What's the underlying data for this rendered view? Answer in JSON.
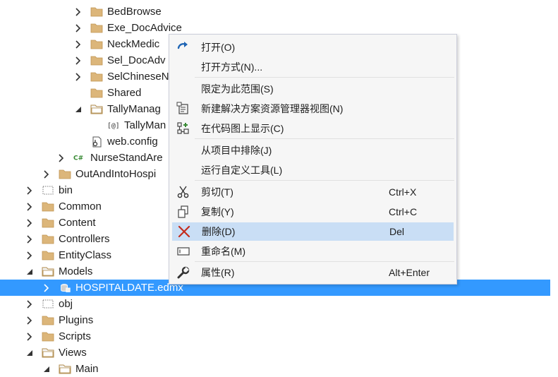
{
  "tree": [
    {
      "label": "BedBrowse",
      "icon": "folder-icon",
      "arrow": "collapsed"
    },
    {
      "label": "Exe_DocAdvice",
      "icon": "folder-icon",
      "arrow": "collapsed"
    },
    {
      "label": "NeckMedic",
      "icon": "folder-icon",
      "arrow": "collapsed"
    },
    {
      "label": "Sel_DocAdv",
      "icon": "folder-icon",
      "arrow": "collapsed"
    },
    {
      "label": "SelChineseN",
      "icon": "folder-icon",
      "arrow": "collapsed"
    },
    {
      "label": "Shared",
      "icon": "folder-icon",
      "arrow": "none"
    },
    {
      "label": "TallyManag",
      "icon": "folder-open-icon",
      "arrow": "expanded"
    },
    {
      "label": "TallyMan",
      "icon": "razor-file-icon",
      "arrow": "none"
    },
    {
      "label": "web.config",
      "icon": "config-file-icon",
      "arrow": "none"
    },
    {
      "label": "NurseStandAre",
      "icon": "csharp-file-icon",
      "arrow": "collapsed",
      "icon_text": "C#"
    },
    {
      "label": "OutAndIntoHospi",
      "icon": "folder-icon",
      "arrow": "collapsed"
    },
    {
      "label": "bin",
      "icon": "folder-dashed-icon",
      "arrow": "collapsed"
    },
    {
      "label": "Common",
      "icon": "folder-icon",
      "arrow": "collapsed"
    },
    {
      "label": "Content",
      "icon": "folder-icon",
      "arrow": "collapsed"
    },
    {
      "label": "Controllers",
      "icon": "folder-icon",
      "arrow": "collapsed"
    },
    {
      "label": "EntityClass",
      "icon": "folder-icon",
      "arrow": "collapsed"
    },
    {
      "label": "Models",
      "icon": "folder-open-icon",
      "arrow": "expanded"
    },
    {
      "label": "HOSPITALDATE.edmx",
      "icon": "edmx-file-icon",
      "arrow": "collapsed",
      "selected": true
    },
    {
      "label": "obj",
      "icon": "folder-dashed-icon",
      "arrow": "collapsed"
    },
    {
      "label": "Plugins",
      "icon": "folder-icon",
      "arrow": "collapsed"
    },
    {
      "label": "Scripts",
      "icon": "folder-icon",
      "arrow": "collapsed"
    },
    {
      "label": "Views",
      "icon": "folder-open-icon",
      "arrow": "expanded"
    },
    {
      "label": "Main",
      "icon": "folder-open-icon",
      "arrow": "expanded"
    }
  ],
  "context_menu": {
    "items": [
      {
        "label": "打开(O)",
        "shortcut": "",
        "icon": "open-arrow-icon"
      },
      {
        "label": "打开方式(N)...",
        "shortcut": "",
        "icon": ""
      },
      {
        "label": "限定为此范围(S)",
        "shortcut": "",
        "icon": ""
      },
      {
        "label": "新建解决方案资源管理器视图(N)",
        "shortcut": "",
        "icon": "new-explorer-view-icon"
      },
      {
        "label": "在代码图上显示(C)",
        "shortcut": "",
        "icon": "code-map-icon"
      },
      {
        "label": "从项目中排除(J)",
        "shortcut": "",
        "icon": ""
      },
      {
        "label": "运行自定义工具(L)",
        "shortcut": "",
        "icon": ""
      },
      {
        "label": "剪切(T)",
        "shortcut": "Ctrl+X",
        "icon": "scissors-icon"
      },
      {
        "label": "复制(Y)",
        "shortcut": "Ctrl+C",
        "icon": "copy-icon"
      },
      {
        "label": "删除(D)",
        "shortcut": "Del",
        "icon": "delete-x-icon",
        "hover": true
      },
      {
        "label": "重命名(M)",
        "shortcut": "",
        "icon": "rename-icon"
      },
      {
        "label": "属性(R)",
        "shortcut": "Alt+Enter",
        "icon": "wrench-icon"
      }
    ]
  },
  "colors": {
    "selection": "#3399ff",
    "menu_hover": "#c9def5",
    "folder": "#dcb67a",
    "delete_red": "#c42b1c",
    "open_blue": "#1e64b4"
  }
}
